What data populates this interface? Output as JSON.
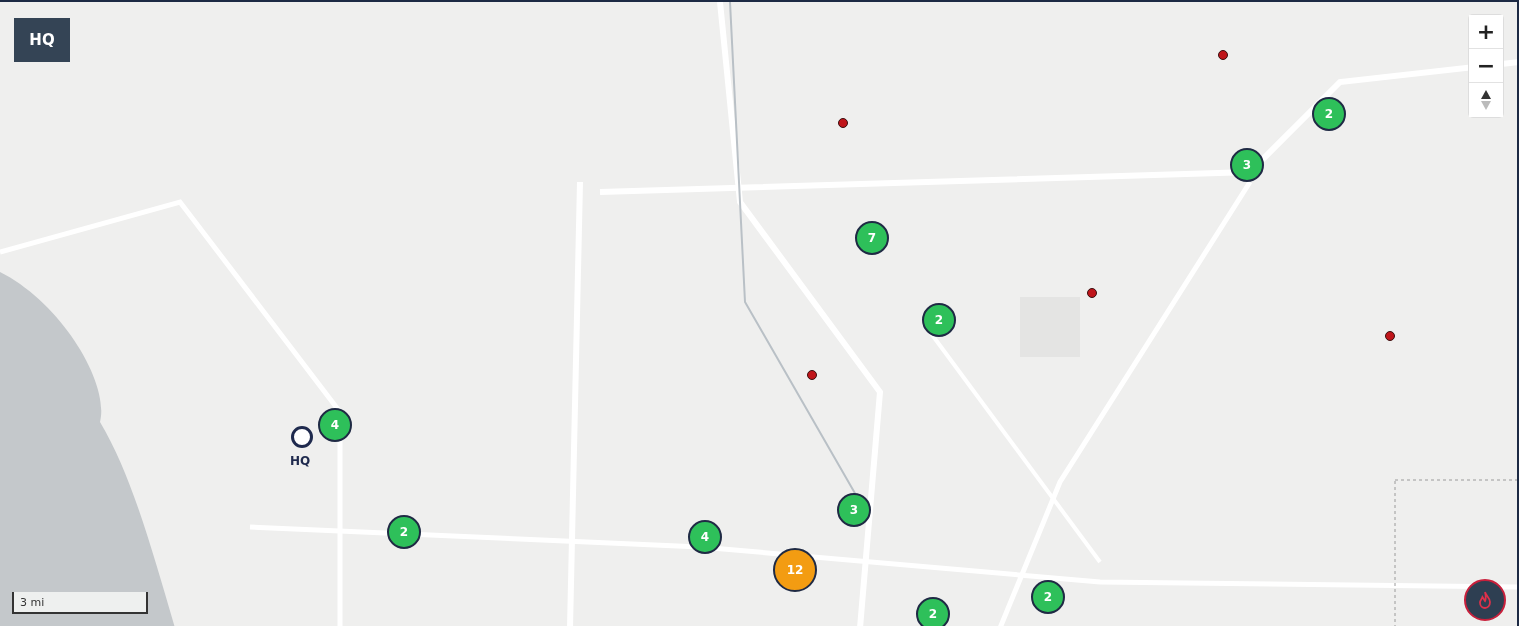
{
  "hq_button": {
    "label": "HQ"
  },
  "zoom_controls": {
    "zoom_in": "+",
    "zoom_out": "−"
  },
  "hq_marker": {
    "label": "HQ"
  },
  "clusters": [
    {
      "count": "2",
      "color": "#2ec05a"
    },
    {
      "count": "3",
      "color": "#2ec05a"
    },
    {
      "count": "7",
      "color": "#2ec05a"
    },
    {
      "count": "2",
      "color": "#2ec05a"
    },
    {
      "count": "4",
      "color": "#2ec05a"
    },
    {
      "count": "3",
      "color": "#2ec05a"
    },
    {
      "count": "2",
      "color": "#2ec05a"
    },
    {
      "count": "4",
      "color": "#2ec05a"
    },
    {
      "count": "12",
      "color": "#f39c12"
    },
    {
      "count": "2",
      "color": "#2ec05a"
    },
    {
      "count": "2",
      "color": "#2ec05a"
    }
  ],
  "scale_bar": {
    "label": "3 mi"
  }
}
